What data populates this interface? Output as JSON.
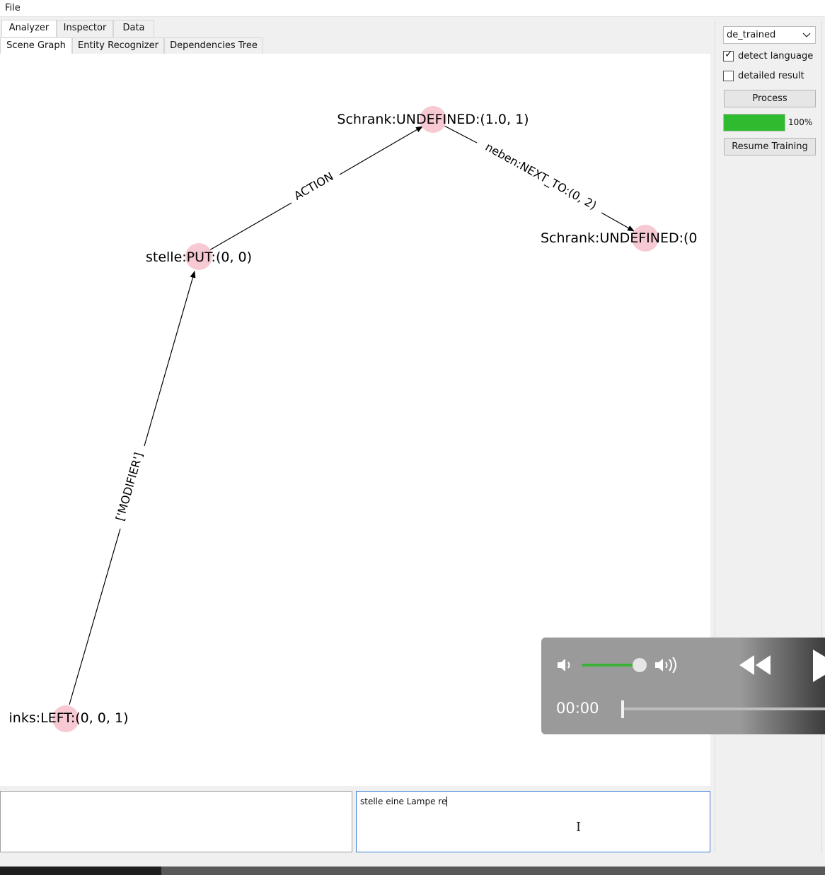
{
  "menubar": {
    "file": "File"
  },
  "tabs_top": [
    "Analyzer",
    "Inspector",
    "Data"
  ],
  "tabs_sub": [
    "Scene Graph",
    "Entity Recognizer",
    "Dependencies Tree"
  ],
  "graph": {
    "nodes": [
      {
        "id": "schrank1",
        "label": "Schrank:UNDEFINED:(1.0, 1)"
      },
      {
        "id": "schrank2",
        "label": "Schrank:UNDEFINED:(0"
      },
      {
        "id": "stelle",
        "label": "stelle:PUT:(0, 0)"
      },
      {
        "id": "links",
        "label": "inks:LEFT:(0, 0, 1)"
      }
    ],
    "edges": [
      {
        "from": "stelle",
        "to": "schrank1",
        "label": "ACTION"
      },
      {
        "from": "schrank1",
        "to": "schrank2",
        "label": "neben:NEXT_TO:(0, 2)"
      },
      {
        "from": "links",
        "to": "stelle",
        "label": "['MODIFIER']"
      }
    ],
    "node_color": "#f7c9d2"
  },
  "side": {
    "model": "de_trained",
    "detect_language": {
      "label": "detect language",
      "checked": true
    },
    "detailed_result": {
      "label": "detailed result",
      "checked": false
    },
    "process": "Process",
    "progress_value": 1.0,
    "progress_text": "100%",
    "resume": "Resume Training",
    "progress_color": "#2ebb30"
  },
  "input": {
    "text": "stelle eine Lampe re"
  },
  "player": {
    "time": "00:00",
    "volume": 0.85,
    "accent": "#3bb036"
  }
}
